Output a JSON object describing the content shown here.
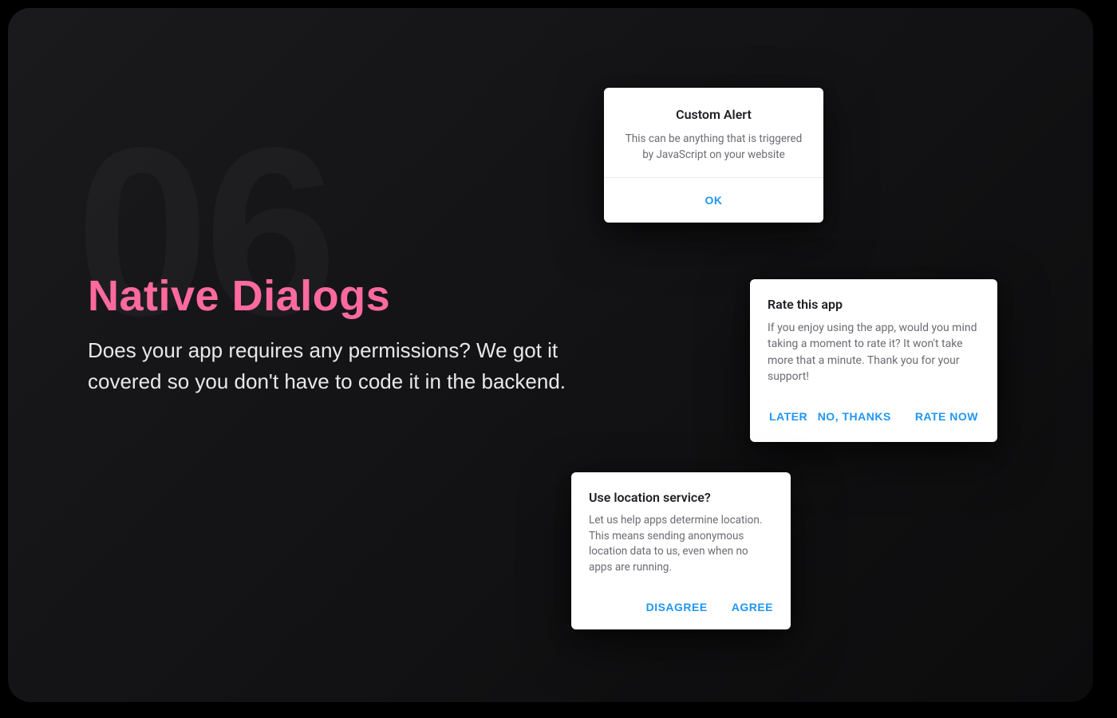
{
  "section_number": "06",
  "hero": {
    "title": "Native Dialogs",
    "subtitle": "Does your app requires any permissions? We got it covered so you don't have to code it in the backend."
  },
  "dialogs": {
    "alert": {
      "title": "Custom Alert",
      "body": "This can be anything that is triggered by JavaScript on your website",
      "ok": "OK"
    },
    "rate": {
      "title": "Rate this app",
      "body": "If you enjoy using the app, would you mind taking a moment to rate it? It won't take more that a minute. Thank you for your support!",
      "later": "LATER",
      "no_thanks": "NO, THANKS",
      "rate_now": "RATE NOW"
    },
    "location": {
      "title": "Use location service?",
      "body": "Let us help apps determine location. This means sending anonymous location data to us, even when no apps are running.",
      "disagree": "DISAGREE",
      "agree": "AGREE"
    }
  }
}
